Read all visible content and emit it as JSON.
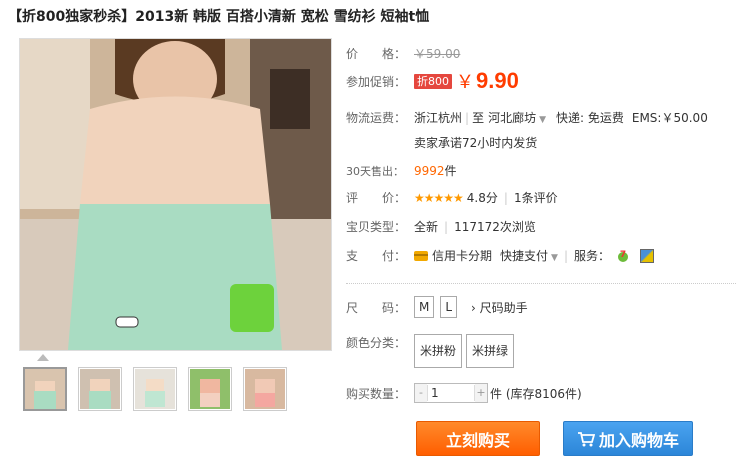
{
  "title": "【折800独家秒杀】2013新 韩版 百搭小清新 宽松 雪纺衫 短袖t恤",
  "price": {
    "label": "价　　格：",
    "original": "￥59.00",
    "promo_label": "参加促销：",
    "promo_badge": "折800",
    "currency": "￥",
    "current": "9.90"
  },
  "shipping": {
    "label": "物流运费：",
    "from": "浙江杭州",
    "to_prefix": "至",
    "to": "河北廊坊",
    "express": "快递: 免运费",
    "ems": "EMS:￥50.00",
    "promise": "卖家承诺72小时内发货"
  },
  "sales": {
    "label": "30天售出：",
    "count": "9992",
    "unit": "件"
  },
  "rating": {
    "label": "评　　价：",
    "stars": "★★★★★",
    "score": "4.8分",
    "reviews": "1条评价"
  },
  "type": {
    "label": "宝贝类型：",
    "condition": "全新",
    "views": "117172次浏览"
  },
  "payment": {
    "label": "支　　付：",
    "credit": "信用卡分期",
    "quick": "快捷支付",
    "service_label": "服务："
  },
  "size": {
    "label": "尺　　码：",
    "options": [
      "M",
      "L"
    ],
    "helper": "› 尺码助手"
  },
  "color": {
    "label": "颜色分类：",
    "options": [
      "米拼粉",
      "米拼绿"
    ]
  },
  "quantity": {
    "label": "购买数量：",
    "value": "1",
    "minus": "-",
    "plus": "+",
    "stock": "件 (库存8106件)"
  },
  "actions": {
    "buy": "立刻购买",
    "cart": "加入购物车"
  },
  "colors": {
    "price": "#ff3c00",
    "buy": "#ff6a00",
    "cart": "#3395e6"
  }
}
